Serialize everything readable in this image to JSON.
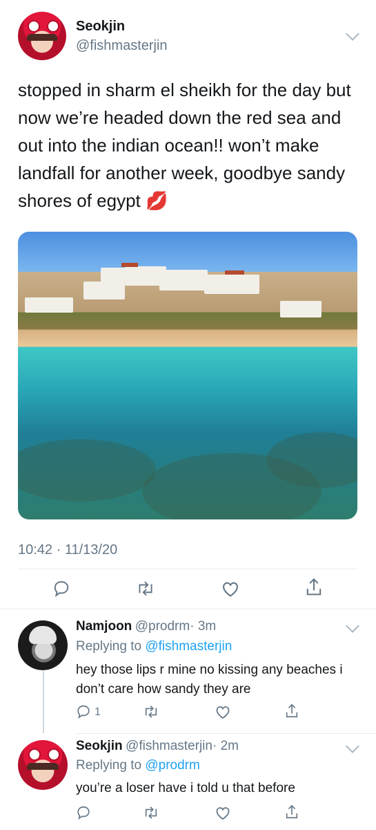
{
  "main_tweet": {
    "name": "Seokjin",
    "handle": "@fishmasterjin",
    "text": "stopped in sharm el sheikh for the day but now we’re headed down the red sea and out into the indian ocean!! won’t make landfall for another week, goodbye sandy shores of egypt 💋",
    "timestamp": "10:42 · 11/13/20",
    "actions": [
      "reply-icon",
      "retweet-icon",
      "like-icon",
      "share-icon"
    ]
  },
  "replies": [
    {
      "name": "Namjoon",
      "handle": "@prodrm",
      "time": "· 3m",
      "replying_label": "Replying to",
      "replying_to": "@fishmasterjin",
      "text": "hey those lips r mine no kissing any beaches i don’t care how sandy they are",
      "reply_count": "1"
    },
    {
      "name": "Seokjin",
      "handle": "@fishmasterjin",
      "time": "· 2m",
      "replying_label": "Replying to",
      "replying_to": "@prodrm",
      "text": "you’re a loser have i told u that before",
      "reply_count": ""
    }
  ],
  "colors": {
    "link": "#1da1f2",
    "secondary_text": "#657786",
    "divider": "#e6ecf0"
  }
}
